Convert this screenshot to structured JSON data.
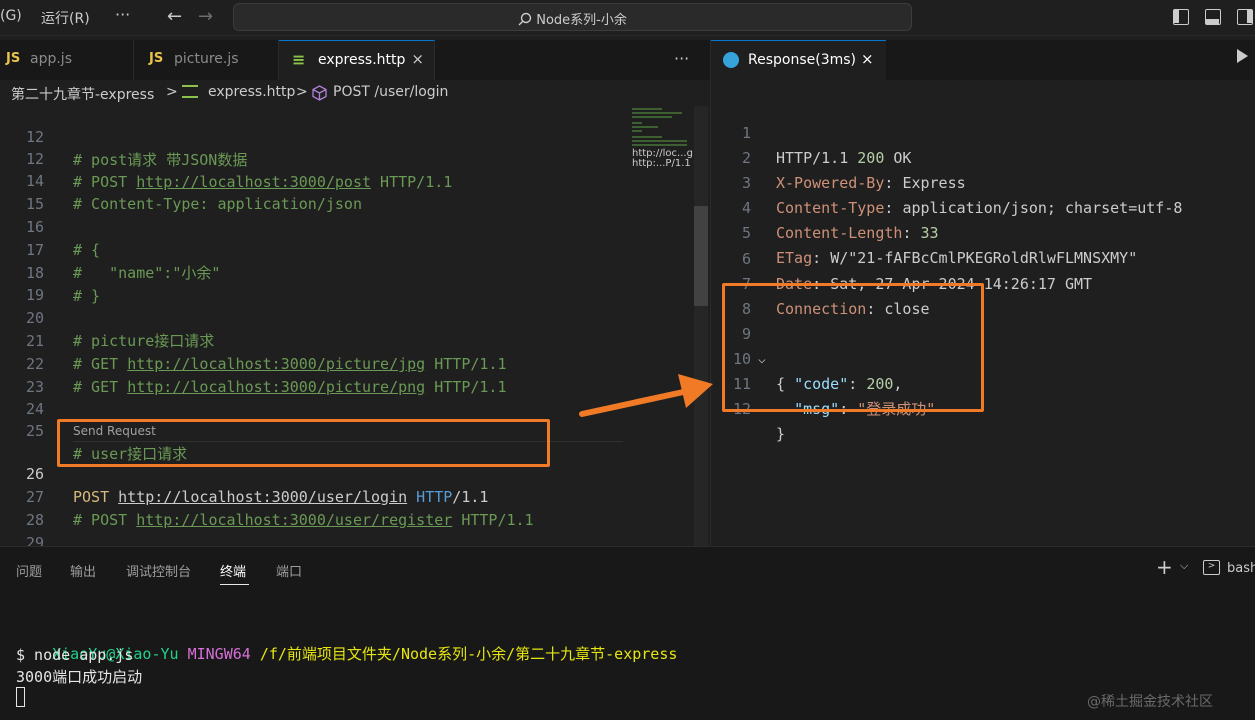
{
  "titlebar": {
    "menu_partial": "(G)",
    "menu_run": "运行(R)",
    "menu_more": "···",
    "back_arrow": "←",
    "forward_arrow": "→",
    "search_text": "Node系列-小余"
  },
  "tabs": [
    {
      "icon": "JS",
      "label": "app.js"
    },
    {
      "icon": "JS",
      "label": "picture.js"
    },
    {
      "icon": "≡",
      "label": "express.http",
      "close": "×"
    }
  ],
  "tab_more": "···",
  "breadcrumb": {
    "folder": "第二十九章节-express",
    "sep1": ">",
    "file": "express.http",
    "sep2": ">",
    "symbol": "POST /user/login"
  },
  "editor": {
    "lines": [
      {
        "num": "12",
        "text": "# post请求 带JSON数据"
      },
      {
        "num": "12",
        "text": "# POST ",
        "url": "http://localhost:3000/post",
        "rest": " HTTP/1.1"
      },
      {
        "num": "14",
        "text": "# Content-Type: application/json"
      },
      {
        "num": "15",
        "text": ""
      },
      {
        "num": "16",
        "text": "# {"
      },
      {
        "num": "17",
        "text": "#   \"name\":\"小余\""
      },
      {
        "num": "18",
        "text": "# }"
      },
      {
        "num": "19",
        "text": ""
      },
      {
        "num": "20",
        "text": "# picture接口请求"
      },
      {
        "num": "21",
        "text": "# GET ",
        "url": "http://localhost:3000/picture/jpg",
        "rest": " HTTP/1.1"
      },
      {
        "num": "22",
        "text": "# GET ",
        "url": "http://localhost:3000/picture/png",
        "rest": " HTTP/1.1"
      },
      {
        "num": "23",
        "text": ""
      },
      {
        "num": "24",
        "text": ""
      },
      {
        "num": "25",
        "text": "# user接口请求"
      }
    ],
    "codelens": "Send Request",
    "current_line": {
      "num": "26",
      "method": "POST",
      "url": "http://localhost:3000/user/login",
      "http": "HTTP",
      "version": "/1.1"
    },
    "after_lines": [
      {
        "num": "27",
        "text": "# POST ",
        "url": "http://localhost:3000/user/register",
        "rest": " HTTP/1.1"
      },
      {
        "num": "28",
        "text": ""
      },
      {
        "num": "29",
        "text": ""
      }
    ],
    "minimap_text_1": "http://loc...g",
    "minimap_text_2": "http:...P/1.1"
  },
  "response_tab": {
    "label": "Response(3ms)",
    "close": "×"
  },
  "response": {
    "status": {
      "num": "1",
      "proto": "HTTP/1.1 ",
      "code": "200",
      "text": " OK"
    },
    "headers": [
      {
        "num": "2",
        "key": "X-Powered-By",
        "value": "Express"
      },
      {
        "num": "3",
        "key": "Content-Type",
        "value": "application/json; charset=utf-8"
      },
      {
        "num": "4",
        "key": "Content-Length",
        "value": "33"
      },
      {
        "num": "5",
        "key": "ETag",
        "value": "W/\"21-fAFBcCmlPKEGRoldRlwFLMNSXMY\""
      },
      {
        "num": "6",
        "key": "Date",
        "value": "Sat, 27 Apr 2024 14:26:17 GMT"
      },
      {
        "num": "7",
        "key": "Connection",
        "value": "close"
      }
    ],
    "blank_num": "8",
    "body": {
      "open": {
        "num": "9",
        "text": "{"
      },
      "code": {
        "num": "10",
        "key": "\"code\"",
        "value": "200"
      },
      "msg": {
        "num": "11",
        "key": "\"msg\"",
        "value": "\"登录成功\""
      },
      "close": {
        "num": "12",
        "text": "}"
      }
    }
  },
  "panel": {
    "tabs": [
      "问题",
      "输出",
      "调试控制台",
      "终端",
      "端口"
    ],
    "active_tab": "终端",
    "plus": "+",
    "chevron": "⌵",
    "shell": "bash"
  },
  "terminal": {
    "user": "XiaoYu@Xiao-Yu",
    "env": "MINGW64",
    "path": "/f/前端项目文件夹/Node系列-小余/第二十九章节-express",
    "command": "$ node app.js",
    "output": "3000端口成功启动"
  },
  "watermark": "@稀土掘金技术社区",
  "colors": {
    "accent": "#0078d4",
    "highlight_box": "#f07a25",
    "comment": "#6a9955",
    "header_key": "#ce9178",
    "json_key": "#9cdcfe"
  }
}
